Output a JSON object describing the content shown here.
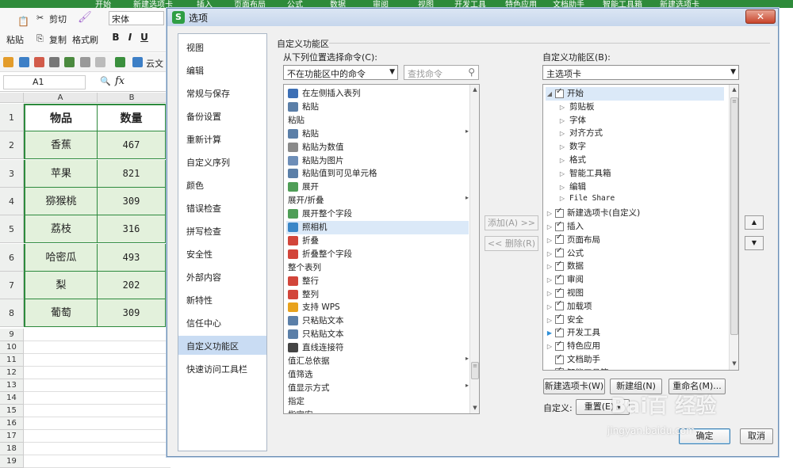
{
  "app": {
    "ribbon_tabs": [
      "开始",
      "新建选项卡",
      "插入",
      "页面布局",
      "公式",
      "数据",
      "审阅",
      "视图",
      "开发工具",
      "特色应用",
      "文档助手",
      "智能工具箱",
      "新建选项卡"
    ],
    "ribbon": {
      "paste": "粘贴",
      "cut": "剪切",
      "copy": "复制",
      "format_painter": "格式刷",
      "font": "宋体",
      "bold": "B",
      "italic": "I",
      "underline": "U",
      "cloud_doc": "云文"
    },
    "name_box": "A1",
    "fx": "fx"
  },
  "sheet": {
    "columns": [
      "A",
      "B"
    ],
    "rows": [
      {
        "n": "1",
        "a": "物品",
        "b": "数量"
      },
      {
        "n": "2",
        "a": "香蕉",
        "b": "467"
      },
      {
        "n": "3",
        "a": "苹果",
        "b": "821"
      },
      {
        "n": "4",
        "a": "猕猴桃",
        "b": "309"
      },
      {
        "n": "5",
        "a": "荔枝",
        "b": "316"
      },
      {
        "n": "6",
        "a": "哈密瓜",
        "b": "493"
      },
      {
        "n": "7",
        "a": "梨",
        "b": "202"
      },
      {
        "n": "8",
        "a": "葡萄",
        "b": "309"
      }
    ],
    "empty_rows": [
      "9",
      "10",
      "11",
      "12",
      "13",
      "14",
      "15",
      "16",
      "17",
      "18",
      "19"
    ]
  },
  "dialog": {
    "title": "选项",
    "close": "✕",
    "nav": [
      "视图",
      "编辑",
      "常规与保存",
      "备份设置",
      "重新计算",
      "自定义序列",
      "颜色",
      "错误检查",
      "拼写检查",
      "安全性",
      "外部内容",
      "新特性",
      "信任中心",
      "自定义功能区",
      "快速访问工具栏"
    ],
    "nav_active": "自定义功能区",
    "section_title": "自定义功能区",
    "choose_from_label": "从下列位置选择命令(C):",
    "choose_from_value": "不在功能区中的命令",
    "search_placeholder": "查找命令",
    "customize_label": "自定义功能区(B):",
    "customize_value": "主选项卡",
    "commands": [
      {
        "t": "在左侧插入表列",
        "icon": "#3d6fb5",
        "sub": ""
      },
      {
        "t": "粘贴",
        "icon": "#5b7fa8",
        "sub": ""
      },
      {
        "t": "粘贴",
        "icon": "",
        "sub": ""
      },
      {
        "t": "粘贴",
        "icon": "#5b7fa8",
        "sub": "▸"
      },
      {
        "t": "粘贴为数值",
        "icon": "#8a8a8a",
        "sub": ""
      },
      {
        "t": "粘贴为图片",
        "icon": "#6d8eb8",
        "sub": ""
      },
      {
        "t": "粘贴值到可见单元格",
        "icon": "#5b7fa8",
        "sub": ""
      },
      {
        "t": "展开",
        "icon": "#4f9e57",
        "sub": ""
      },
      {
        "t": "展开/折叠",
        "icon": "",
        "sub": "▸"
      },
      {
        "t": "展开整个字段",
        "icon": "#4f9e57",
        "sub": ""
      },
      {
        "t": "照相机",
        "icon": "#3a86c7",
        "sub": ""
      },
      {
        "t": "折叠",
        "icon": "#d2453a",
        "sub": ""
      },
      {
        "t": "折叠整个字段",
        "icon": "#d2453a",
        "sub": ""
      },
      {
        "t": "整个表列",
        "icon": "",
        "sub": ""
      },
      {
        "t": "整行",
        "icon": "#d2453a",
        "sub": ""
      },
      {
        "t": "整列",
        "icon": "#d2453a",
        "sub": ""
      },
      {
        "t": "支持 WPS",
        "icon": "#e8a21d",
        "sub": ""
      },
      {
        "t": "只粘贴文本",
        "icon": "#5b7fa8",
        "sub": ""
      },
      {
        "t": "只粘贴文本",
        "icon": "#5b7fa8",
        "sub": ""
      },
      {
        "t": "直线连接符",
        "icon": "#444444",
        "sub": ""
      },
      {
        "t": "值汇总依据",
        "icon": "",
        "sub": "▸"
      },
      {
        "t": "值筛选",
        "icon": "",
        "sub": ""
      },
      {
        "t": "值显示方式",
        "icon": "",
        "sub": "▸"
      },
      {
        "t": "指定",
        "icon": "",
        "sub": ""
      },
      {
        "t": "指定宏",
        "icon": "",
        "sub": ""
      }
    ],
    "highlight_command": "照相机",
    "add_button": "添加(A) >>",
    "remove_button": "<< 删除(R)",
    "tree": [
      {
        "t": "开始",
        "level": 0,
        "exp": "◢",
        "cb": true
      },
      {
        "t": "剪贴板",
        "level": 1,
        "exp": "▷",
        "cb": false
      },
      {
        "t": "字体",
        "level": 1,
        "exp": "▷",
        "cb": false
      },
      {
        "t": "对齐方式",
        "level": 1,
        "exp": "▷",
        "cb": false
      },
      {
        "t": "数字",
        "level": 1,
        "exp": "▷",
        "cb": false
      },
      {
        "t": "格式",
        "level": 1,
        "exp": "▷",
        "cb": false
      },
      {
        "t": "智能工具箱",
        "level": 1,
        "exp": "▷",
        "cb": false
      },
      {
        "t": "编辑",
        "level": 1,
        "exp": "▷",
        "cb": false
      },
      {
        "t": "File Share",
        "level": 1,
        "exp": "▷",
        "cb": false
      },
      {
        "t": "新建选项卡(自定义)",
        "level": 0,
        "exp": "▷",
        "cb": true
      },
      {
        "t": "插入",
        "level": 0,
        "exp": "▷",
        "cb": true
      },
      {
        "t": "页面布局",
        "level": 0,
        "exp": "▷",
        "cb": true
      },
      {
        "t": "公式",
        "level": 0,
        "exp": "▷",
        "cb": true
      },
      {
        "t": "数据",
        "level": 0,
        "exp": "▷",
        "cb": true
      },
      {
        "t": "审阅",
        "level": 0,
        "exp": "▷",
        "cb": true
      },
      {
        "t": "视图",
        "level": 0,
        "exp": "▷",
        "cb": true
      },
      {
        "t": "加载项",
        "level": 0,
        "exp": "▷",
        "cb": true
      },
      {
        "t": "安全",
        "level": 0,
        "exp": "▷",
        "cb": true
      },
      {
        "t": "开发工具",
        "level": 0,
        "exp": "▶",
        "cb": true
      },
      {
        "t": "特色应用",
        "level": 0,
        "exp": "▷",
        "cb": true
      },
      {
        "t": "文档助手",
        "level": 0,
        "exp": "",
        "cb": true
      },
      {
        "t": "智能工具箱",
        "level": 0,
        "exp": "",
        "cb": true
      }
    ],
    "new_tab_button": "新建选项卡(W)",
    "new_group_button": "新建组(N)",
    "rename_button": "重命名(M)...",
    "customize_reset_label": "自定义:",
    "reset_button": "重置(E) ▾",
    "ok_button": "确定",
    "cancel_button": "取消",
    "move_up": "▲",
    "move_down": "▼"
  },
  "watermark": {
    "brand": "Bai百 经验",
    "url": "jingyan.baidu.com"
  }
}
